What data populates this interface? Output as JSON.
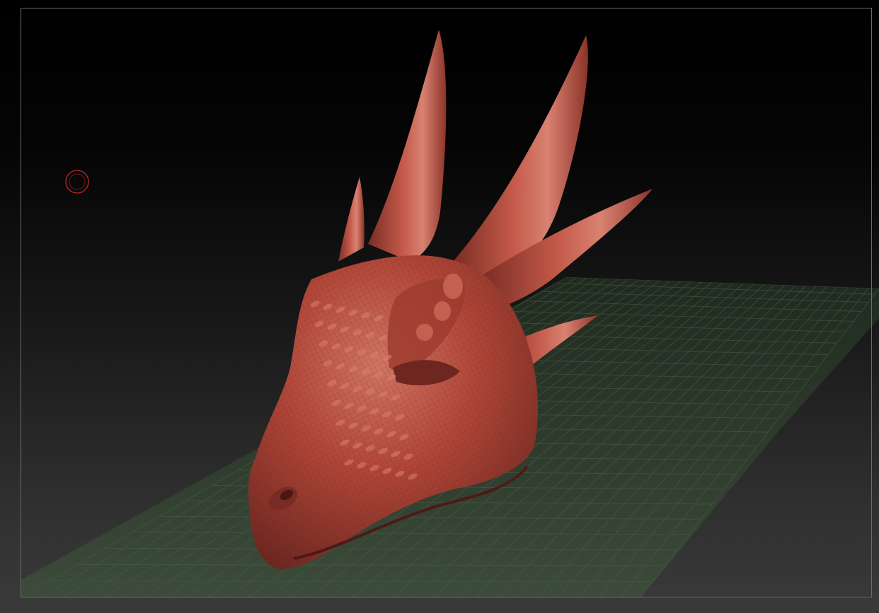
{
  "viewport": {
    "background_top": "#000000",
    "background_bottom": "#3a3a3a",
    "frame_color": "#6b6b6b"
  },
  "floor_grid": {
    "fill": "#2c3a2c",
    "line_color": "#4d5e4b"
  },
  "model": {
    "name": "dragon-head",
    "material_color": "#b4473a",
    "material_shadow": "#6f2a22",
    "material_highlight": "#d98070"
  },
  "cursor": {
    "icon": "brush-circle-icon",
    "color": "#c0282a"
  }
}
